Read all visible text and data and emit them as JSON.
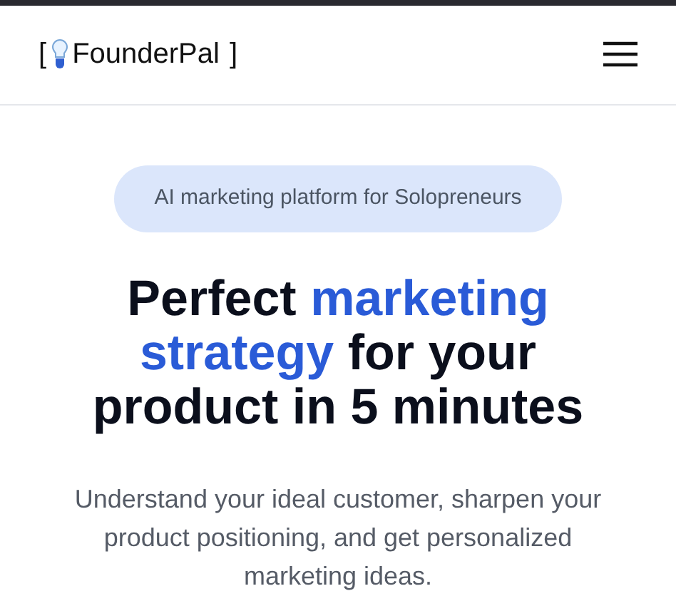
{
  "header": {
    "logo": {
      "open_bracket": "[",
      "name": "FounderPal",
      "close_bracket": "]"
    }
  },
  "hero": {
    "badge": "AI marketing platform for Solopreneurs",
    "headline": [
      {
        "text": "Perfect ",
        "highlighted": false
      },
      {
        "text": "marketing strategy",
        "highlighted": true
      },
      {
        "text": " for your product in 5 minutes",
        "highlighted": false
      }
    ],
    "description": "Understand your ideal customer, sharpen your product positioning, and get personalized marketing ideas."
  }
}
